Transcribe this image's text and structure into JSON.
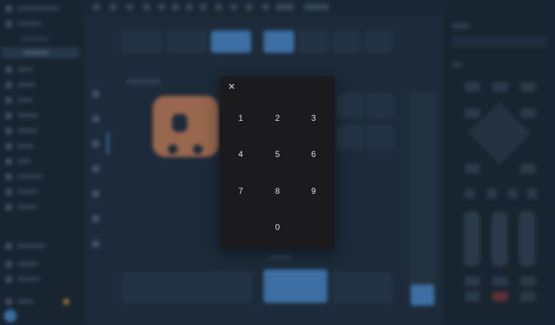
{
  "numpad": {
    "close_glyph": "✕",
    "keys": [
      "1",
      "2",
      "3",
      "4",
      "5",
      "6",
      "7",
      "8",
      "9",
      "0"
    ]
  },
  "colors": {
    "modal_bg": "#1b1b1d",
    "app_bg": "#223243",
    "accent": "#4d8dd0",
    "logo": "#c7835f"
  }
}
